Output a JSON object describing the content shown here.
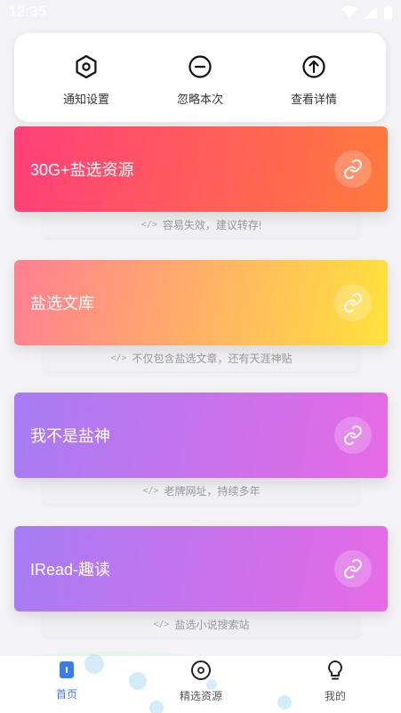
{
  "status_bar": {
    "time": "12:35"
  },
  "notice": {
    "actions": [
      {
        "icon": "hexagon-settings-icon",
        "label": "通知设置"
      },
      {
        "icon": "minus-circle-icon",
        "label": "忽略本次"
      },
      {
        "icon": "arrow-up-circle-icon",
        "label": "查看详情"
      }
    ]
  },
  "resources": [
    {
      "title": "30G+盐选资源",
      "subtitle": "容易失效，建议转存!",
      "gradient": [
        "#ff3f7a",
        "#ff7a3c"
      ]
    },
    {
      "title": "盐选文库",
      "subtitle": "不仅包含盐选文章，还有天涯神贴",
      "gradient": [
        "#ff7f92",
        "#ffe23c"
      ]
    },
    {
      "title": "我不是盐神",
      "subtitle": "老牌网址，持续多年",
      "gradient": [
        "#a67cf2",
        "#e66ae6"
      ]
    },
    {
      "title": "IRead-趣读",
      "subtitle": "盐选小说搜索站",
      "gradient": [
        "#a67cf2",
        "#e66ae6"
      ]
    }
  ],
  "bottom_nav": {
    "items": [
      {
        "icon": "home-icon",
        "label": "首页",
        "active": true
      },
      {
        "icon": "compass-icon",
        "label": "精选资源",
        "active": false
      },
      {
        "icon": "bulb-icon",
        "label": "我的",
        "active": false
      }
    ],
    "active_color": "#3a7bf0",
    "inactive_color": "#555555"
  }
}
